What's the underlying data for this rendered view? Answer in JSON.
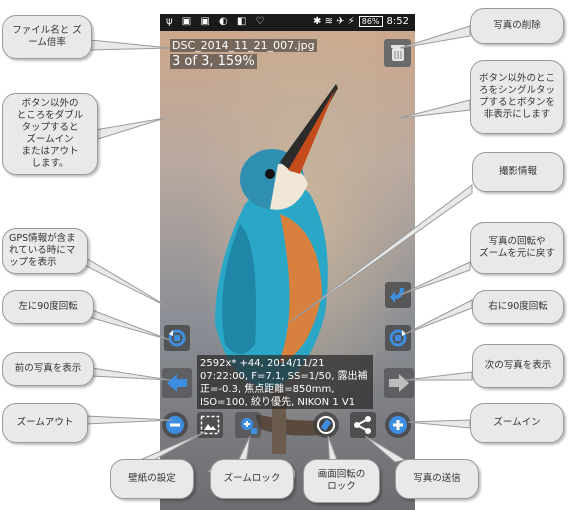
{
  "phone": {
    "statusbar": {
      "battery": "86%",
      "time": "8:52"
    },
    "filename": "DSC_2014_11_21_007.jpg",
    "position_zoom": "3 of 3, 159%",
    "exif": "2592x* +44, 2014/11/21 07:22:00, F=7.1, SS=1/50, 露出補正=-0.3, 焦点距離=850mm, ISO=100, 絞り優先, NIKON 1 V1"
  },
  "callouts": {
    "filename_zoom": "ファイル名と\nズーム倍率",
    "double_tap": "ボタン以外の\nところをダブル\nタップすると\nズームイン\nまたはアウト\nします。",
    "gps_map": "GPS情報が含まれている時にマップを表示",
    "rotate_left": "左に90度回転",
    "prev_photo": "前の写真を表示",
    "zoom_out": "ズームアウト",
    "wallpaper": "壁紙の設定",
    "zoom_lock": "ズームロック",
    "rotation_lock": "画面回転の\nロック",
    "send_photo": "写真の送信",
    "zoom_in": "ズームイン",
    "next_photo": "次の写真を表示",
    "rotate_right": "右に90度回転",
    "reset_rotation_zoom": "写真の回転や\nズームを元に戻す",
    "shooting_info": "撮影情報",
    "single_tap": "ボタン以外のところをシングルタップするとボタンを非表示にします",
    "delete_photo": "写真の削除"
  },
  "colors": {
    "accent_blue": "#3d8ee0",
    "callout_fill": "#e9e9e9"
  }
}
